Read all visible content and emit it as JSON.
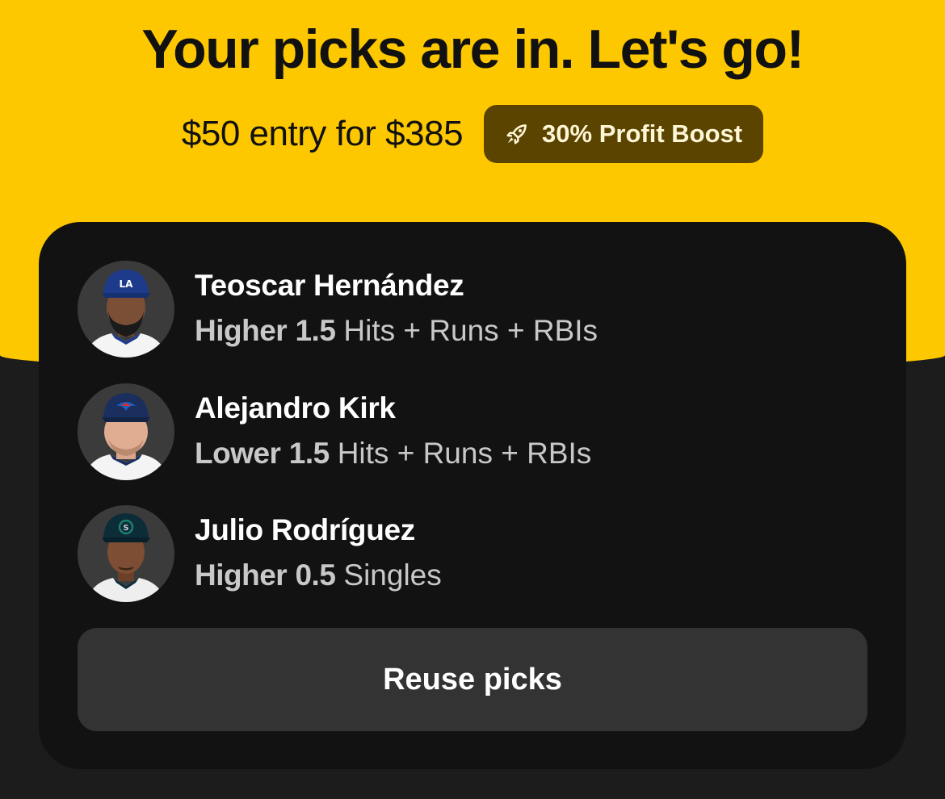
{
  "header": {
    "title": "Your picks are in. Let's go!",
    "entry_text": "$50 entry for $385",
    "boost": {
      "icon": "rocket-icon",
      "label": "30% Profit Boost"
    }
  },
  "picks": [
    {
      "player": "Teoscar Hernández",
      "direction": "Higher",
      "line": "1.5",
      "stat": "Hits + Runs + RBIs",
      "cap_color": "#1e3a8a",
      "cap_logo": "LA"
    },
    {
      "player": "Alejandro Kirk",
      "direction": "Lower",
      "line": "1.5",
      "stat": "Hits + Runs + RBIs",
      "cap_color": "#1b2f5e",
      "cap_logo": "bird"
    },
    {
      "player": "Julio Rodríguez",
      "direction": "Higher",
      "line": "0.5",
      "stat": "Singles",
      "cap_color": "#0c2c38",
      "cap_logo": "S"
    }
  ],
  "actions": {
    "reuse_label": "Reuse picks"
  },
  "colors": {
    "brand_yellow": "#fec800",
    "boost_badge": "#5a4400",
    "card": "#121212",
    "button": "#333333"
  }
}
